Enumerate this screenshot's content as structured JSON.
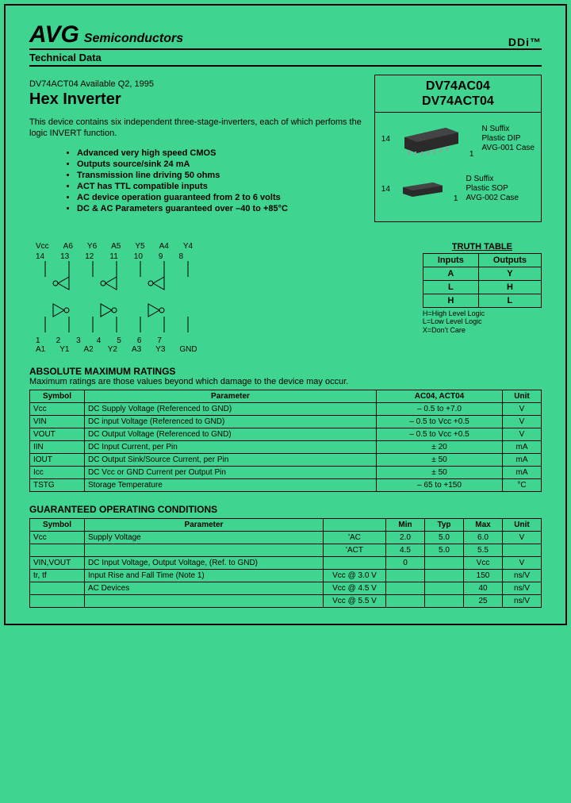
{
  "header": {
    "brand": "AVG",
    "sub": "Semiconductors",
    "right": "DDi™",
    "tech": "Technical Data"
  },
  "main": {
    "avail": "DV74ACT04 Available Q2, 1995",
    "title": "Hex Inverter",
    "desc": "This device contains six independent three-stage-inverters, each of which perfoms the logic INVERT function.",
    "bullets": [
      "Advanced very high speed CMOS",
      "Outputs source/sink 24 mA",
      "Transmission line driving 50 ohms",
      "ACT has TTL compatible inputs",
      "AC device operation guaranteed  from 2 to 6 volts",
      "DC & AC Parameters guaranteed over –40 to +85°C"
    ]
  },
  "partbox": {
    "p1": "DV74AC04",
    "p2": "DV74ACT04",
    "pkg1": {
      "suffix": "N Suffix",
      "type": "Plastic DIP",
      "case": "AVG-001 Case",
      "pin_lo": "1",
      "pin_hi": "14"
    },
    "pkg2": {
      "suffix": "D Suffix",
      "type": "Plastic SOP",
      "case": "AVG-002 Case",
      "pin_lo": "1",
      "pin_hi": "14"
    }
  },
  "pinout": {
    "top_labels": [
      "Vcc",
      "A6",
      "Y6",
      "A5",
      "Y5",
      "A4",
      "Y4"
    ],
    "top_nums": [
      "14",
      "13",
      "12",
      "11",
      "10",
      "9",
      "8"
    ],
    "bot_nums": [
      "1",
      "2",
      "3",
      "4",
      "5",
      "6",
      "7"
    ],
    "bot_labels": [
      "A1",
      "Y1",
      "A2",
      "Y2",
      "A3",
      "Y3",
      "GND"
    ]
  },
  "truth": {
    "title": "TRUTH TABLE",
    "h_in": "Inputs",
    "h_out": "Outputs",
    "sub_in": "A",
    "sub_out": "Y",
    "rows": [
      [
        "L",
        "H"
      ],
      [
        "H",
        "L"
      ]
    ],
    "legend": [
      "H=High Level Logic",
      "L=Low Level Logic",
      "X=Don't Care"
    ]
  },
  "amr": {
    "title": "ABSOLUTE MAXIMUM RATINGS",
    "note": "Maximum ratings are those values beyond which damage to the device may occur.",
    "headers": [
      "Symbol",
      "Parameter",
      "AC04, ACT04",
      "Unit"
    ],
    "rows": [
      [
        "Vcc",
        "DC Supply Voltage (Referenced to GND)",
        "– 0.5 to +7.0",
        "V"
      ],
      [
        "VIN",
        "DC input Voltage (Referenced to GND)",
        "– 0.5 to Vcc +0.5",
        "V"
      ],
      [
        "VOUT",
        "DC Output Voltage (Referenced to GND)",
        "– 0.5 to Vcc +0.5",
        "V"
      ],
      [
        "IIN",
        "DC Input Current, per Pin",
        "± 20",
        "mA"
      ],
      [
        "IOUT",
        "DC Output Sink/Source Current, per Pin",
        "± 50",
        "mA"
      ],
      [
        "Icc",
        "DC Vcc or GND Current per Output Pin",
        "± 50",
        "mA"
      ],
      [
        "TSTG",
        "Storage Temperature",
        "– 65 to  +150",
        "°C"
      ]
    ]
  },
  "goc": {
    "title": "GUARANTEED OPERATING CONDITIONS",
    "headers": [
      "Symbol",
      "Parameter",
      "",
      "Min",
      "Typ",
      "Max",
      "Unit"
    ],
    "rows": [
      [
        "Vcc",
        "Supply Voltage",
        "'AC",
        "2.0",
        "5.0",
        "6.0",
        "V"
      ],
      [
        "",
        "",
        "'ACT",
        "4.5",
        "5.0",
        "5.5",
        ""
      ],
      [
        "VIN,VOUT",
        "DC Input Voltage, Output Voltage, (Ref. to GND)",
        "",
        "0",
        "",
        "Vcc",
        "V"
      ],
      [
        "tr, tf",
        "Input Rise and Fall Time (Note 1)",
        "Vcc @ 3.0 V",
        "",
        "",
        "150",
        "ns/V"
      ],
      [
        "",
        "AC Devices",
        "Vcc @ 4.5 V",
        "",
        "",
        "40",
        "ns/V"
      ],
      [
        "",
        "",
        "Vcc @ 5.5 V",
        "",
        "",
        "25",
        "ns/V"
      ]
    ]
  }
}
